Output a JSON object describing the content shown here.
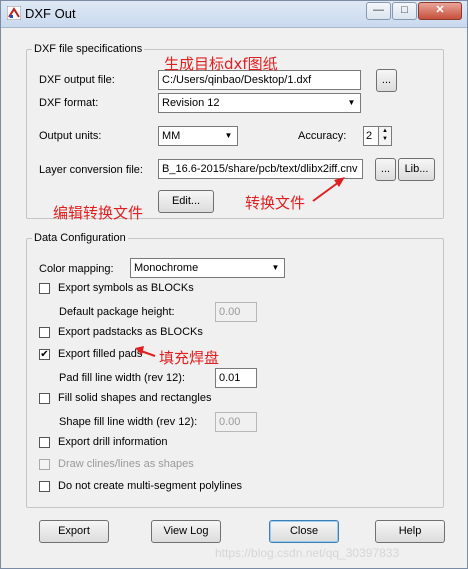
{
  "window": {
    "title": "DXF Out",
    "minimize_glyph": "—",
    "maximize_glyph": "□",
    "close_glyph": "✕"
  },
  "dxf_spec": {
    "legend": "DXF file specifications",
    "output_file_label": "DXF output file:",
    "output_file_value": "C:/Users/qinbao/Desktop/1.dxf",
    "browse_label": "...",
    "format_label": "DXF format:",
    "format_value": "Revision 12",
    "units_label": "Output units:",
    "units_value": "MM",
    "accuracy_label": "Accuracy:",
    "accuracy_value": "2",
    "layer_label": "Layer conversion file:",
    "layer_value": "B_16.6-2015/share/pcb/text/dlibx2iff.cnv",
    "layer_browse_label": "...",
    "lib_label": "Lib...",
    "edit_label": "Edit..."
  },
  "data_config": {
    "legend": "Data Configuration",
    "color_mapping_label": "Color mapping:",
    "color_mapping_value": "Monochrome",
    "export_symbols_label": "Export symbols as BLOCKs",
    "export_symbols_checked": false,
    "pkg_height_label": "Default package height:",
    "pkg_height_value": "0.00",
    "export_padstacks_label": "Export padstacks as BLOCKs",
    "export_padstacks_checked": false,
    "export_filled_label": "Export filled pads",
    "export_filled_checked": true,
    "pad_fill_label": "Pad fill line width (rev 12):",
    "pad_fill_value": "0.01",
    "fill_solid_label": "Fill solid shapes and rectangles",
    "fill_solid_checked": false,
    "shape_fill_label": "Shape fill line width (rev 12):",
    "shape_fill_value": "0.00",
    "export_drill_label": "Export drill information",
    "export_drill_checked": false,
    "draw_clines_label": "Draw clines/lines as shapes",
    "draw_clines_checked": false,
    "no_multi_label": "Do not create multi-segment polylines",
    "no_multi_checked": false
  },
  "buttons": {
    "export": "Export",
    "view_log": "View Log",
    "close": "Close",
    "help": "Help"
  },
  "annotations": {
    "generate_target": "生成目标dxf图纸",
    "edit_conversion": "编辑转换文件",
    "conversion_file": "转换文件",
    "fill_pads": "填充焊盘"
  },
  "watermark": "https://blog.csdn.net/qq_30397833",
  "colors": {
    "annotation": "#e02020",
    "title_bar": "#c9d9ee",
    "close_button": "#c7503d"
  }
}
